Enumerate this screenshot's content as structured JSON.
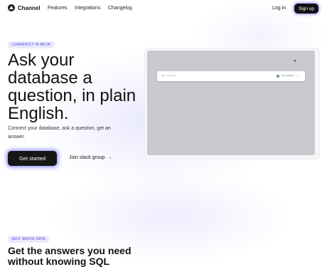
{
  "nav": {
    "brand": "Channel",
    "links": [
      "Features",
      "Integrations",
      "Changelog"
    ],
    "login": "Log in",
    "signup": "Sign up"
  },
  "hero": {
    "badge": "CURRENTLY IN BETA!",
    "headline": "Ask your database a question, in plain English.",
    "subtext": "Connect your database, ask a question, get an answer.",
    "cta": "Get started",
    "secondary": "Join slack group",
    "secondary_arrow": "→"
  },
  "preview": {
    "query_placeholder": "Ask a question...",
    "database_label": "Get database",
    "chevron": "⌄"
  },
  "section2": {
    "badge": "SELF SERVE DATA",
    "title": "Get the answers you need without knowing SQL"
  }
}
